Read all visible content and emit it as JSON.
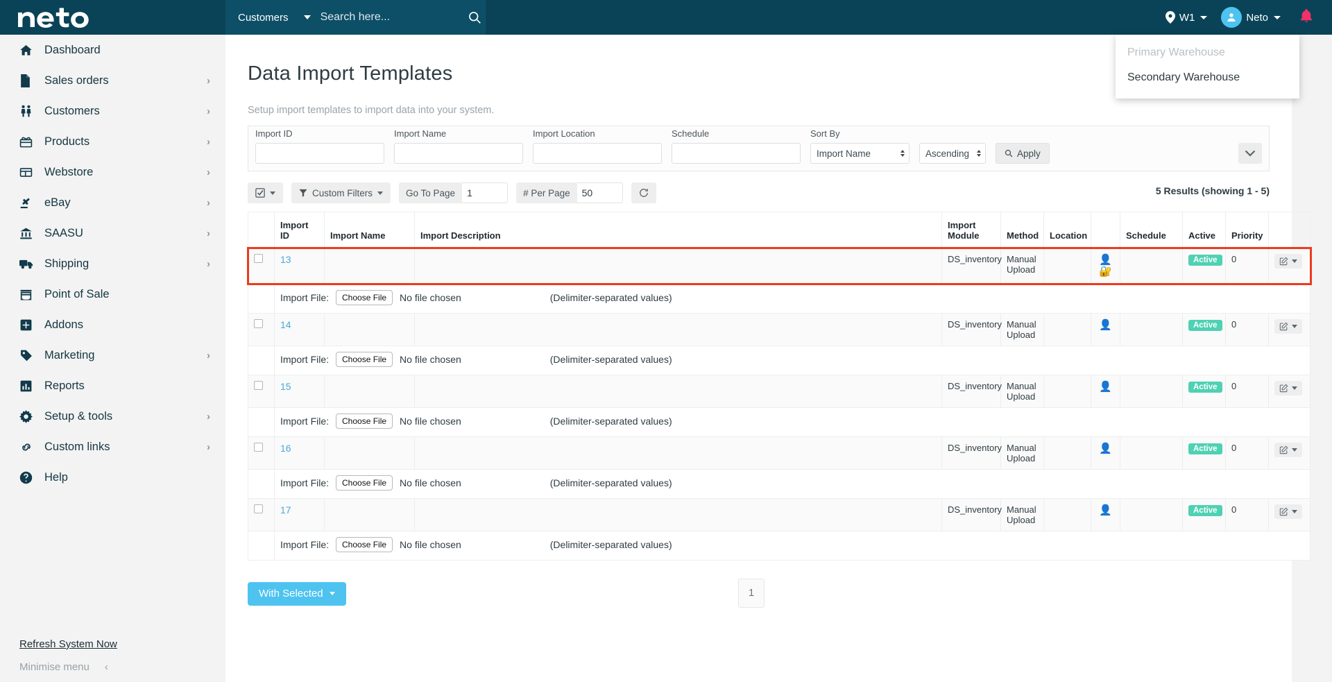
{
  "topbar": {
    "brand": "neto",
    "search_category": "Customers",
    "search_placeholder": "Search here...",
    "warehouse_label": "W1",
    "user_label": "Neto"
  },
  "warehouse_dropdown": {
    "items": [
      {
        "label": "Primary Warehouse",
        "disabled": true
      },
      {
        "label": "Secondary Warehouse",
        "disabled": false
      }
    ]
  },
  "sidebar": {
    "items": [
      {
        "label": "Dashboard",
        "icon": "home-icon",
        "chevron": false
      },
      {
        "label": "Sales orders",
        "icon": "document-icon",
        "chevron": true
      },
      {
        "label": "Customers",
        "icon": "people-icon",
        "chevron": true
      },
      {
        "label": "Products",
        "icon": "products-icon",
        "chevron": true
      },
      {
        "label": "Webstore",
        "icon": "webstore-icon",
        "chevron": true
      },
      {
        "label": "eBay",
        "icon": "gavel-icon",
        "chevron": true
      },
      {
        "label": "SAASU",
        "icon": "bank-icon",
        "chevron": true
      },
      {
        "label": "Shipping",
        "icon": "truck-icon",
        "chevron": true
      },
      {
        "label": "Point of Sale",
        "icon": "store-icon",
        "chevron": false
      },
      {
        "label": "Addons",
        "icon": "plus-square-icon",
        "chevron": false
      },
      {
        "label": "Marketing",
        "icon": "tag-icon",
        "chevron": true
      },
      {
        "label": "Reports",
        "icon": "bar-chart-icon",
        "chevron": false
      },
      {
        "label": "Setup & tools",
        "icon": "gear-icon",
        "chevron": true
      },
      {
        "label": "Custom links",
        "icon": "link-icon",
        "chevron": true
      },
      {
        "label": "Help",
        "icon": "question-circle-icon",
        "chevron": false
      }
    ],
    "refresh_label": "Refresh System Now",
    "minimise_label": "Minimise menu"
  },
  "page": {
    "title": "Data Import Templates",
    "subtitle": "Setup import templates to import data into your system."
  },
  "filters": {
    "import_id": {
      "label": "Import ID",
      "value": ""
    },
    "import_name": {
      "label": "Import Name",
      "value": ""
    },
    "import_location": {
      "label": "Import Location",
      "value": ""
    },
    "schedule": {
      "label": "Schedule",
      "value": ""
    },
    "sort_by": {
      "label": "Sort By",
      "value": "Import Name"
    },
    "sort_dir": {
      "value": "Ascending"
    },
    "apply_label": "Apply"
  },
  "toolbar": {
    "custom_filters_label": "Custom Filters",
    "go_to_page_label": "Go To Page",
    "go_to_page_value": "1",
    "per_page_label": "# Per Page",
    "per_page_value": "50",
    "results_text": "5 Results (showing 1 - 5)"
  },
  "table": {
    "headers": {
      "import_id": "Import ID",
      "import_name": "Import Name",
      "import_description": "Import Description",
      "import_module": "Import Module",
      "method": "Method",
      "location": "Location",
      "schedule": "Schedule",
      "active": "Active",
      "priority": "Priority"
    },
    "file_row": {
      "label": "Import File:",
      "button": "Choose File",
      "no_file": "No file chosen",
      "note": "(Delimiter-separated values)"
    },
    "rows": [
      {
        "id": "13",
        "name": "",
        "description": "",
        "module": "DS_inventory",
        "method": "Manual Upload",
        "location": "",
        "icons": [
          "bust-in-silhouette-emoji",
          "locked-with-key-emoji"
        ],
        "schedule": "",
        "active": "Active",
        "priority": "0",
        "highlighted": true
      },
      {
        "id": "14",
        "name": "",
        "description": "",
        "module": "DS_inventory",
        "method": "Manual Upload",
        "location": "",
        "icons": [
          "bust-in-silhouette-emoji"
        ],
        "schedule": "",
        "active": "Active",
        "priority": "0",
        "highlighted": false
      },
      {
        "id": "15",
        "name": "",
        "description": "",
        "module": "DS_inventory",
        "method": "Manual Upload",
        "location": "",
        "icons": [
          "bust-in-silhouette-emoji"
        ],
        "schedule": "",
        "active": "Active",
        "priority": "0",
        "highlighted": false
      },
      {
        "id": "16",
        "name": "",
        "description": "",
        "module": "DS_inventory",
        "method": "Manual Upload",
        "location": "",
        "icons": [
          "bust-in-silhouette-emoji"
        ],
        "schedule": "",
        "active": "Active",
        "priority": "0",
        "highlighted": false
      },
      {
        "id": "17",
        "name": "",
        "description": "",
        "module": "DS_inventory",
        "method": "Manual Upload",
        "location": "",
        "icons": [
          "bust-in-silhouette-emoji"
        ],
        "schedule": "",
        "active": "Active",
        "priority": "0",
        "highlighted": false
      }
    ]
  },
  "footer": {
    "with_selected_label": "With  Selected",
    "page_number": "1"
  },
  "colors": {
    "topbar": "#0a4357",
    "search_bg": "#0d4f66",
    "accent_blue": "#4ec3f0",
    "badge_green": "#4fd1b3",
    "highlight_red": "#ee3a1d",
    "link_blue": "#49a9dc",
    "sidebar_bg": "#f3f3f3"
  }
}
